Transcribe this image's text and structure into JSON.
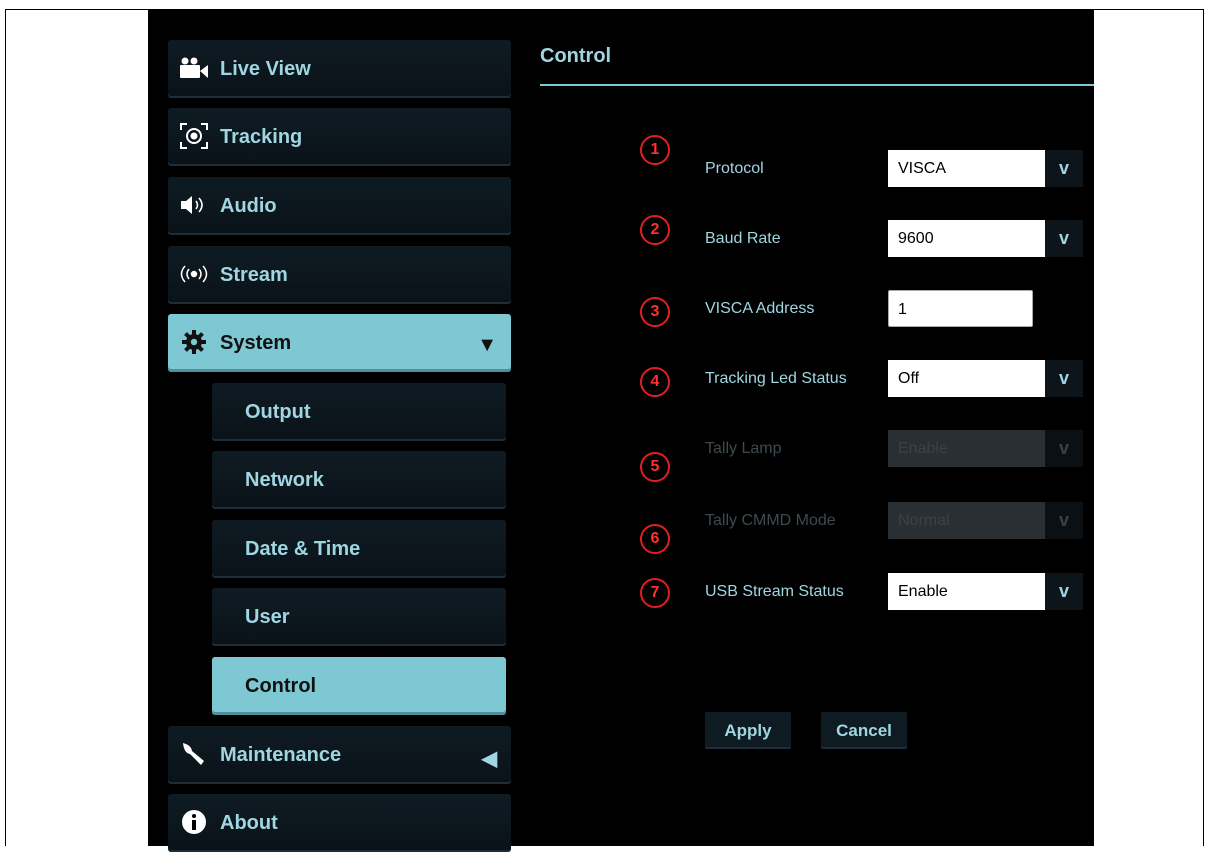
{
  "sidebar": {
    "items": [
      {
        "label": "Live View",
        "icon": "video-camera-icon"
      },
      {
        "label": "Tracking",
        "icon": "tracking-target-icon"
      },
      {
        "label": "Audio",
        "icon": "speaker-icon"
      },
      {
        "label": "Stream",
        "icon": "broadcast-icon"
      },
      {
        "label": "System",
        "icon": "gear-icon",
        "expanded": true,
        "arrow": "▼"
      },
      {
        "label": "Maintenance",
        "icon": "wrench-icon",
        "arrow": "◀"
      },
      {
        "label": "About",
        "icon": "info-icon"
      }
    ],
    "system_sub": [
      "Output",
      "Network",
      "Date & Time",
      "User",
      "Control"
    ],
    "active_sub": "Control"
  },
  "page": {
    "title": "Control"
  },
  "form": {
    "protocol": {
      "num": "1",
      "label": "Protocol",
      "value": "VISCA"
    },
    "baud_rate": {
      "num": "2",
      "label": "Baud Rate",
      "value": "9600"
    },
    "visca_address": {
      "num": "3",
      "label": "VISCA Address",
      "value": "1"
    },
    "tracking_led": {
      "num": "4",
      "label": "Tracking Led Status",
      "value": "Off"
    },
    "tally_lamp": {
      "num": "5",
      "label": "Tally Lamp",
      "value": "Enable",
      "disabled": true
    },
    "tally_cmmd": {
      "num": "6",
      "label": "Tally CMMD Mode",
      "value": "Normal",
      "disabled": true
    },
    "usb_stream": {
      "num": "7",
      "label": "USB Stream Status",
      "value": "Enable"
    }
  },
  "buttons": {
    "apply": "Apply",
    "cancel": "Cancel"
  },
  "colors": {
    "accent": "#7ec8d4",
    "text": "#9fd6e2",
    "badge": "#e02020"
  }
}
